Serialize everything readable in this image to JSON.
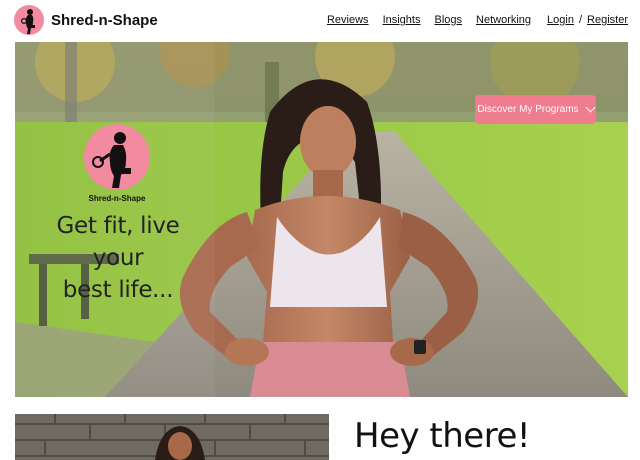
{
  "header": {
    "brand": "Shred-n-Shape",
    "nav": {
      "reviews": "Reviews",
      "insights": "Insights",
      "blogs": "Blogs",
      "networking": "Networking",
      "login": "Login",
      "separator": "/",
      "register": "Register"
    }
  },
  "hero": {
    "cta_label": "Discover My Programs",
    "logo_text": "Shred-n-Shape",
    "tagline_line1": "Get fit, live your",
    "tagline_line2": "best life...",
    "accent_color": "#f07c8f"
  },
  "about": {
    "greeting": "Hey there!"
  }
}
